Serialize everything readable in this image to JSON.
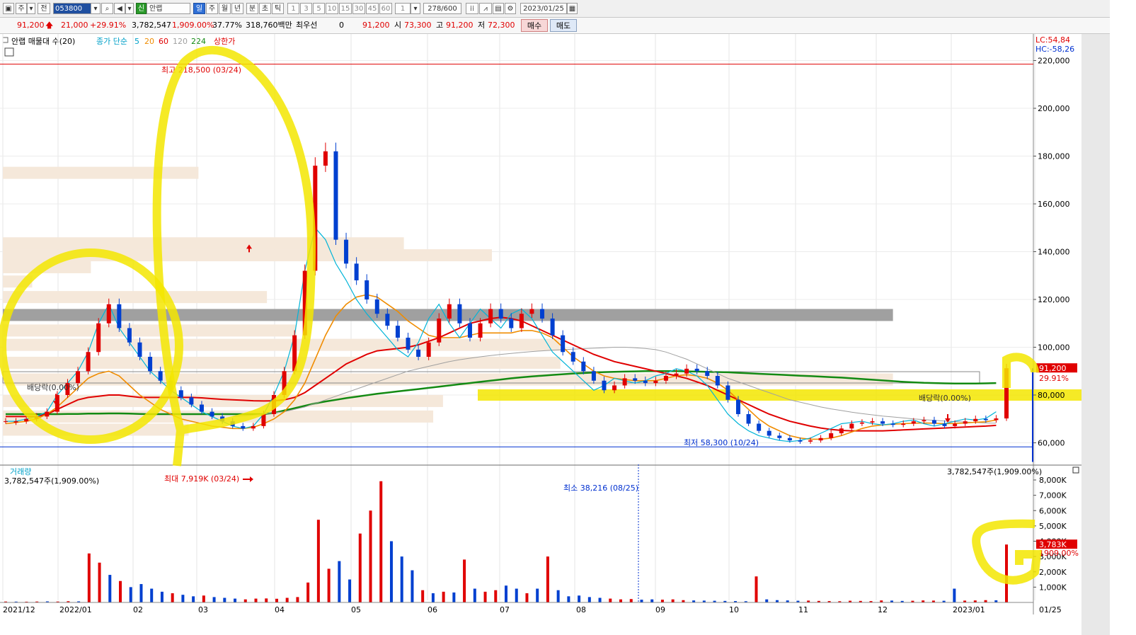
{
  "toolbar": {
    "period_label": "주",
    "jeon_label": "전",
    "code": "053800",
    "shin_badge": "신",
    "name": "안랩",
    "periods": [
      "일",
      "주",
      "월",
      "년",
      "분",
      "초",
      "틱"
    ],
    "minutes": [
      "1",
      "3",
      "5",
      "10",
      "15",
      "30",
      "45",
      "60"
    ],
    "count_value": "1",
    "range_value": "278/600",
    "date_value": "2023/01/25"
  },
  "quote": {
    "price": "91,200",
    "change": "21,000",
    "change_pct": "+29.91%",
    "volume": "3,782,547",
    "volume_pct": "1,909.00%",
    "turnover": "37.77%",
    "amount": "318,760백만",
    "priority_label": "최우선",
    "priority_value": "0",
    "priority_price": "91,200",
    "open_label": "시",
    "open": "73,300",
    "high_label": "고",
    "high": "91,200",
    "low_label": "저",
    "low": "72,300",
    "buy_label": "매수",
    "sell_label": "매도"
  },
  "legend": {
    "title": "안랩 매물대 수(20)",
    "ma_label": "종가 단순",
    "ma5": "5",
    "ma20": "20",
    "ma60": "60",
    "ma120": "120",
    "ma224": "224",
    "limit_label": "상한가",
    "lc": "LC:54,84",
    "hc": "HC:-58,26"
  },
  "colors": {
    "up": "#e00000",
    "down": "#0040d0",
    "ma5": "#00b4d8",
    "ma20": "#f08c00",
    "ma60": "#e00000",
    "ma120": "#a0a0a0",
    "ma224": "#138a13",
    "highlight": "#f3e600",
    "vp_bar": "#f5e8da",
    "vp_max": "#a0a0a0"
  },
  "chart_data": {
    "type": "candlestick",
    "x_labels": [
      "2021/12",
      "2022/01",
      "02",
      "03",
      "04",
      "05",
      "06",
      "07",
      "08",
      "09",
      "10",
      "11",
      "12",
      "2023/01",
      "01/25"
    ],
    "y_ticks": [
      60000,
      80000,
      100000,
      120000,
      140000,
      160000,
      180000,
      200000,
      220000
    ],
    "y_tick_labels": [
      "60,000",
      "80,000",
      "100,000",
      "120,000",
      "140,000",
      "160,000",
      "180,000",
      "200,000",
      "220,000"
    ],
    "ylim": [
      49000,
      225000
    ],
    "price_series": [
      [
        69000,
        69000
      ],
      [
        68500,
        69000
      ],
      [
        69000,
        70000
      ],
      [
        70000,
        71000
      ],
      [
        71000,
        73000
      ],
      [
        73000,
        80000
      ],
      [
        80000,
        85000
      ],
      [
        85000,
        90000
      ],
      [
        90000,
        98000
      ],
      [
        98000,
        110000
      ],
      [
        110000,
        118000
      ],
      [
        118000,
        108000
      ],
      [
        108000,
        102000
      ],
      [
        102000,
        96000
      ],
      [
        96000,
        90000
      ],
      [
        90000,
        86000
      ],
      [
        86000,
        82000
      ],
      [
        82000,
        79000
      ],
      [
        79000,
        76000
      ],
      [
        76000,
        73000
      ],
      [
        73000,
        71000
      ],
      [
        71000,
        69000
      ],
      [
        69000,
        67000
      ],
      [
        67000,
        66000
      ],
      [
        66000,
        67000
      ],
      [
        67000,
        72000
      ],
      [
        72000,
        80000
      ],
      [
        80000,
        90000
      ],
      [
        90000,
        105000
      ],
      [
        105000,
        132000
      ],
      [
        132000,
        176000
      ],
      [
        176000,
        182000
      ],
      [
        182000,
        145000
      ],
      [
        145000,
        135000
      ],
      [
        135000,
        128000
      ],
      [
        128000,
        120000
      ],
      [
        120000,
        114000
      ],
      [
        114000,
        109000
      ],
      [
        109000,
        104000
      ],
      [
        104000,
        99000
      ],
      [
        99000,
        96000
      ],
      [
        96000,
        102000
      ],
      [
        102000,
        112000
      ],
      [
        112000,
        118000
      ],
      [
        118000,
        110000
      ],
      [
        110000,
        104000
      ],
      [
        104000,
        110000
      ],
      [
        110000,
        116000
      ],
      [
        116000,
        112000
      ],
      [
        112000,
        108000
      ],
      [
        108000,
        114000
      ],
      [
        114000,
        116000
      ],
      [
        116000,
        112000
      ],
      [
        112000,
        105000
      ],
      [
        105000,
        98000
      ],
      [
        98000,
        94000
      ],
      [
        94000,
        90000
      ],
      [
        90000,
        86000
      ],
      [
        86000,
        82000
      ],
      [
        82000,
        84000
      ],
      [
        84000,
        87000
      ],
      [
        87000,
        86000
      ],
      [
        86000,
        85000
      ],
      [
        85000,
        86000
      ],
      [
        86000,
        88000
      ],
      [
        88000,
        89000
      ],
      [
        89000,
        91000
      ],
      [
        91000,
        90000
      ],
      [
        90000,
        88000
      ],
      [
        88000,
        84000
      ],
      [
        84000,
        78000
      ],
      [
        78000,
        72000
      ],
      [
        72000,
        68000
      ],
      [
        68000,
        65000
      ],
      [
        65000,
        63000
      ],
      [
        63000,
        62000
      ],
      [
        62000,
        61000
      ],
      [
        61000,
        60500
      ],
      [
        60500,
        61000
      ],
      [
        61000,
        62000
      ],
      [
        62000,
        64000
      ],
      [
        64000,
        66000
      ],
      [
        66000,
        68000
      ],
      [
        68000,
        68500
      ],
      [
        68500,
        69000
      ],
      [
        69000,
        68000
      ],
      [
        68000,
        67500
      ],
      [
        67500,
        68000
      ],
      [
        68000,
        69000
      ],
      [
        69000,
        69500
      ],
      [
        69500,
        68000
      ],
      [
        68000,
        67000
      ],
      [
        67000,
        68000
      ],
      [
        68000,
        69000
      ],
      [
        69000,
        70000
      ],
      [
        70000,
        69500
      ],
      [
        69500,
        70200
      ],
      [
        70200,
        91200
      ]
    ],
    "ma_lines": {
      "ma5": [
        69000,
        69000,
        70000,
        71000,
        73000,
        80000,
        85000,
        90000,
        98000,
        110000,
        118000,
        108000,
        102000,
        96000,
        90000,
        86000,
        82000,
        79000,
        76000,
        73000,
        71000,
        69000,
        67000,
        66000,
        67000,
        72000,
        80000,
        90000,
        105000,
        132000,
        150000,
        145000,
        135000,
        128000,
        120000,
        114000,
        109000,
        104000,
        99000,
        96000,
        102000,
        112000,
        118000,
        110000,
        104000,
        110000,
        116000,
        112000,
        108000,
        114000,
        116000,
        112000,
        105000,
        98000,
        94000,
        90000,
        86000,
        82000,
        84000,
        87000,
        86000,
        85000,
        86000,
        88000,
        89000,
        91000,
        90000,
        88000,
        84000,
        78000,
        72000,
        68000,
        65000,
        63000,
        62000,
        61000,
        60500,
        61000,
        62000,
        64000,
        66000,
        68000,
        68500,
        69000,
        68000,
        67500,
        68000,
        69000,
        69500,
        68000,
        67000,
        68000,
        69000,
        70000,
        69500,
        70200,
        73000
      ],
      "ma20": [
        68000,
        68500,
        69000,
        70000,
        72000,
        75000,
        79000,
        83000,
        87000,
        89000,
        90000,
        88000,
        84000,
        80000,
        77000,
        74000,
        72000,
        70000,
        69000,
        68000,
        67000,
        66500,
        66000,
        66000,
        66500,
        68000,
        70000,
        73000,
        78000,
        85000,
        95000,
        105000,
        113000,
        118000,
        121000,
        122000,
        121000,
        118000,
        115000,
        111000,
        108000,
        105000,
        104000,
        104000,
        104000,
        105000,
        106000,
        106000,
        106000,
        106000,
        107000,
        107000,
        106000,
        104000,
        100000,
        96000,
        93000,
        90000,
        88000,
        87000,
        86500,
        86000,
        86000,
        86000,
        87000,
        88000,
        88500,
        88000,
        87000,
        85000,
        82000,
        78000,
        74000,
        70000,
        67000,
        65000,
        63000,
        62000,
        61500,
        61500,
        62000,
        63000,
        64500,
        66000,
        67000,
        67500,
        67800,
        68000,
        68200,
        68300,
        68200,
        68000,
        68100,
        68300,
        68600,
        68800,
        69500
      ],
      "ma60": [
        71000,
        71000,
        71000,
        71000,
        72000,
        74000,
        76000,
        78000,
        79000,
        79500,
        80000,
        80000,
        79500,
        79000,
        79000,
        79000,
        79000,
        79000,
        79000,
        78800,
        78500,
        78200,
        78000,
        77800,
        77600,
        77500,
        77600,
        78000,
        79000,
        81000,
        84000,
        87000,
        90000,
        93000,
        95000,
        97000,
        98500,
        99000,
        99500,
        100000,
        101000,
        102500,
        104000,
        106000,
        108000,
        110000,
        111000,
        112000,
        112500,
        112000,
        111000,
        109000,
        107000,
        105000,
        103000,
        101000,
        99000,
        97000,
        95500,
        94000,
        93000,
        92000,
        91000,
        90000,
        89000,
        88000,
        87000,
        85500,
        84000,
        82000,
        80000,
        78000,
        76000,
        74000,
        72000,
        70500,
        69000,
        68000,
        67000,
        66200,
        65600,
        65200,
        65000,
        65000,
        65000,
        65000,
        65200,
        65400,
        65600,
        65800,
        66000,
        66200,
        66400,
        66600,
        66800,
        67000,
        67300
      ],
      "ma120": [
        null,
        null,
        null,
        null,
        null,
        null,
        null,
        null,
        null,
        null,
        null,
        null,
        null,
        null,
        null,
        null,
        null,
        null,
        null,
        null,
        null,
        null,
        71000,
        71300,
        71600,
        72000,
        72500,
        73000,
        74000,
        75000,
        76500,
        78000,
        79500,
        81000,
        82500,
        84000,
        85500,
        87000,
        88500,
        90000,
        91000,
        92000,
        93000,
        94000,
        94800,
        95400,
        96000,
        96500,
        97000,
        97400,
        97800,
        98200,
        98500,
        98800,
        99000,
        99200,
        99400,
        99600,
        99800,
        100000,
        100000,
        99800,
        99500,
        99000,
        98000,
        96500,
        95000,
        93000,
        91000,
        89000,
        87000,
        85500,
        84000,
        82500,
        81000,
        79500,
        78000,
        77000,
        76000,
        75000,
        74200,
        73500,
        72800,
        72200,
        71700,
        71200,
        70800,
        70400,
        70000,
        69700,
        69400,
        69100,
        68900,
        68700,
        68500,
        68300,
        68200
      ],
      "ma224": [
        72000,
        72000,
        72000,
        72000,
        72000,
        72000,
        72100,
        72100,
        72200,
        72200,
        72300,
        72300,
        72200,
        72100,
        72000,
        72000,
        72000,
        72000,
        72000,
        72000,
        72000,
        72000,
        72000,
        72000,
        72000,
        72000,
        72500,
        73500,
        74500,
        75500,
        76500,
        77300,
        78000,
        78700,
        79300,
        79900,
        80500,
        81000,
        81500,
        82000,
        82500,
        83000,
        83500,
        84000,
        84500,
        85000,
        85500,
        86000,
        86500,
        87000,
        87400,
        87800,
        88100,
        88400,
        88700,
        89000,
        89200,
        89400,
        89600,
        89700,
        89800,
        89900,
        90000,
        90000,
        90000,
        90000,
        89900,
        89800,
        89700,
        89600,
        89500,
        89300,
        89100,
        88900,
        88700,
        88500,
        88300,
        88100,
        87900,
        87700,
        87500,
        87300,
        87000,
        86700,
        86400,
        86100,
        85800,
        85500,
        85300,
        85100,
        85000,
        84900,
        84800,
        84800,
        84800,
        84900,
        85000
      ]
    },
    "volume_profile": [
      {
        "price": 65500,
        "width": 0.19
      },
      {
        "price": 71000,
        "width": 0.44
      },
      {
        "price": 77500,
        "width": 0.45
      },
      {
        "price": 86500,
        "width": 0.91
      },
      {
        "price": 93500,
        "width": 0.57
      },
      {
        "price": 101000,
        "width": 0.57
      },
      {
        "price": 107000,
        "width": 0.3
      },
      {
        "price": 113500,
        "width": 0.91
      },
      {
        "price": 121000,
        "width": 0.27
      },
      {
        "price": 127500,
        "width": 0.03
      },
      {
        "price": 133500,
        "width": 0.09
      },
      {
        "price": 138500,
        "width": 0.5
      },
      {
        "price": 143500,
        "width": 0.41
      },
      {
        "price": 173000,
        "width": 0.2
      }
    ],
    "annotations": {
      "high": "최고 218,500 (03/24)",
      "low": "최저 58,300 (10/24)",
      "ex_div_1": "배당락(0.00%)",
      "ex_div_2": "배당락(0.00%)",
      "last_price": "91,200",
      "last_pct": "29.91%"
    },
    "volume": {
      "title": "거래량",
      "current": "3,782,547주(1,909.00%)",
      "max_label": "최대 7,919K (03/24)",
      "min_label": "최소 38,216 (08/25)",
      "y_ticks": [
        1000,
        2000,
        3000,
        4000,
        5000,
        6000,
        7000,
        8000
      ],
      "y_tick_labels": [
        "1,000K",
        "2,000K",
        "3,000K",
        "4,000K",
        "5,000K",
        "6,000K",
        "7,000K",
        "8,000K"
      ],
      "last_label": "3,783K",
      "last_pct": "1909.00%",
      "values_k": [
        60,
        55,
        50,
        60,
        70,
        60,
        80,
        70,
        3200,
        2600,
        1800,
        1400,
        1000,
        1200,
        900,
        700,
        600,
        500,
        400,
        450,
        350,
        300,
        250,
        200,
        250,
        260,
        240,
        300,
        350,
        1300,
        5400,
        2200,
        2700,
        1500,
        4500,
        6000,
        7919,
        4000,
        3000,
        2100,
        800,
        600,
        700,
        650,
        2800,
        900,
        700,
        800,
        1100,
        900,
        600,
        900,
        3000,
        800,
        400,
        450,
        350,
        300,
        250,
        200,
        220,
        180,
        200,
        180,
        200,
        150,
        130,
        120,
        110,
        100,
        90,
        80,
        1700,
        200,
        150,
        130,
        110,
        120,
        100,
        90,
        80,
        110,
        100,
        90,
        130,
        120,
        100,
        110,
        130,
        120,
        110,
        900,
        120,
        130,
        150,
        140,
        3783
      ],
      "up_flags": [
        1,
        0,
        1,
        1,
        0,
        1,
        1,
        0,
        1,
        1,
        0,
        1,
        0,
        0,
        0,
        0,
        1,
        0,
        0,
        1,
        0,
        0,
        0,
        1,
        1,
        1,
        1,
        1,
        1,
        1,
        1,
        1,
        0,
        0,
        1,
        1,
        1,
        0,
        0,
        0,
        1,
        0,
        1,
        0,
        1,
        0,
        1,
        1,
        0,
        0,
        1,
        0,
        1,
        0,
        0,
        0,
        0,
        0,
        1,
        1,
        1,
        0,
        0,
        1,
        1,
        1,
        0,
        0,
        0,
        0,
        0,
        0,
        1,
        0,
        0,
        0,
        0,
        1,
        1,
        1,
        1,
        1,
        1,
        1,
        1,
        0,
        0,
        1,
        1,
        1,
        0,
        0,
        1,
        1,
        1,
        0,
        1
      ]
    }
  }
}
